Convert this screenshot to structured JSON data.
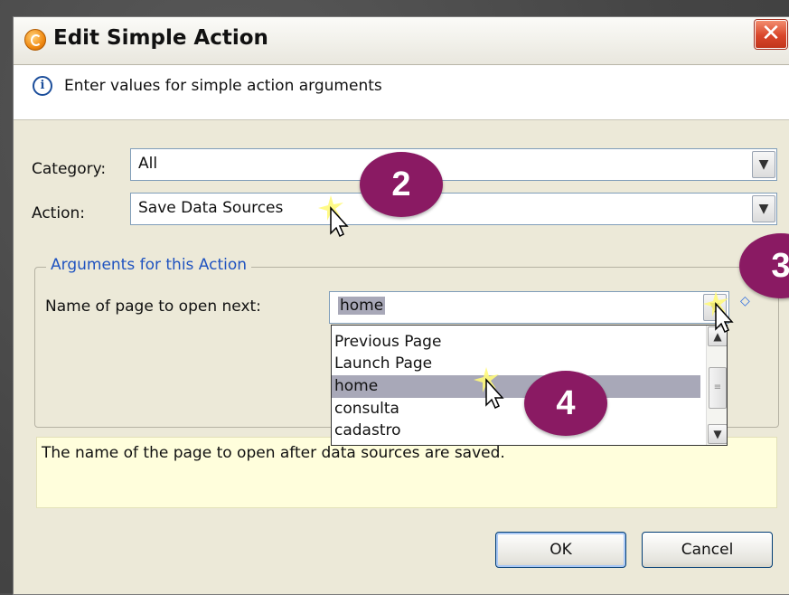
{
  "dialog": {
    "title": "Edit Simple Action",
    "close_glyph": "✕",
    "info_text": "Enter values for simple action arguments"
  },
  "form": {
    "category_label": "Category:",
    "category_value": "All",
    "action_label": "Action:",
    "action_value": "Save Data Sources",
    "group_title": "Arguments for this Action",
    "page_label": "Name of page to open next:",
    "page_value": "home"
  },
  "dropdown": {
    "items": [
      "Previous Page",
      "Launch Page",
      "home",
      "consulta",
      "cadastro"
    ],
    "highlighted_index": 2
  },
  "description": "The name of the page to open after data sources are saved.",
  "buttons": {
    "ok": "OK",
    "cancel": "Cancel"
  },
  "markers": {
    "m2": "2",
    "m3": "3",
    "m4": "4"
  },
  "colors": {
    "marker": "#8a1a63",
    "link_blue": "#1f53c0",
    "highlight": "#a8a8b8"
  },
  "icons": [
    "app-icon",
    "close-icon",
    "info-icon",
    "chevron-down-icon",
    "pin-icon",
    "cursor-icon"
  ]
}
